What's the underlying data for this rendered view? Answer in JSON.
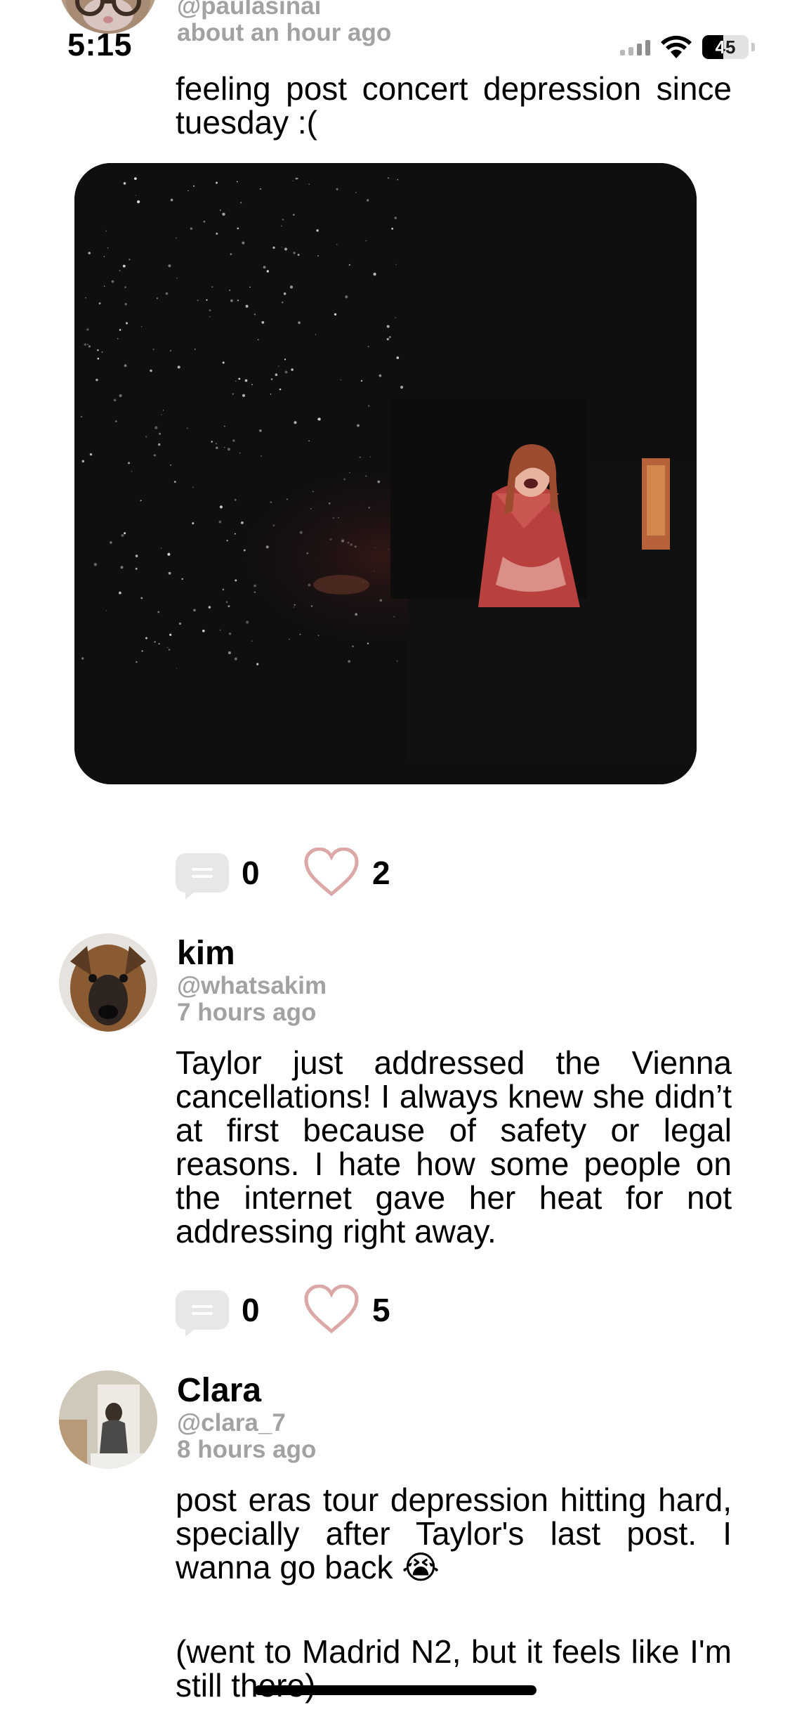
{
  "status_bar": {
    "time": "5:15",
    "battery": "45",
    "battery_level": 0.45
  },
  "posts": [
    {
      "handle": "@paulasinai",
      "time": "about an hour ago",
      "text": "feeling post concert depression since tuesday :(",
      "comments": "0",
      "likes": "2"
    },
    {
      "name": "kim",
      "handle": "@whatsakim",
      "time": "7 hours ago",
      "text": "Taylor just addressed the Vienna cancellations! I always knew she didn’t at first because of safety or legal reasons. I hate how some people on the internet gave her heat for not addressing right away.",
      "comments": "0",
      "likes": "5"
    },
    {
      "name": "Clara",
      "handle": "@clara_7",
      "time": "8 hours ago",
      "text_line1": "post eras tour depression hitting hard, specially after Taylor's last post. I wanna go back 😭",
      "text_line2": "(went to Madrid N2, but it feels like I'm still there)"
    }
  ],
  "colors": {
    "heart": "#dba7a7",
    "muted_text": "#a2a2a2",
    "comment_bubble": "#e7e7e7"
  }
}
